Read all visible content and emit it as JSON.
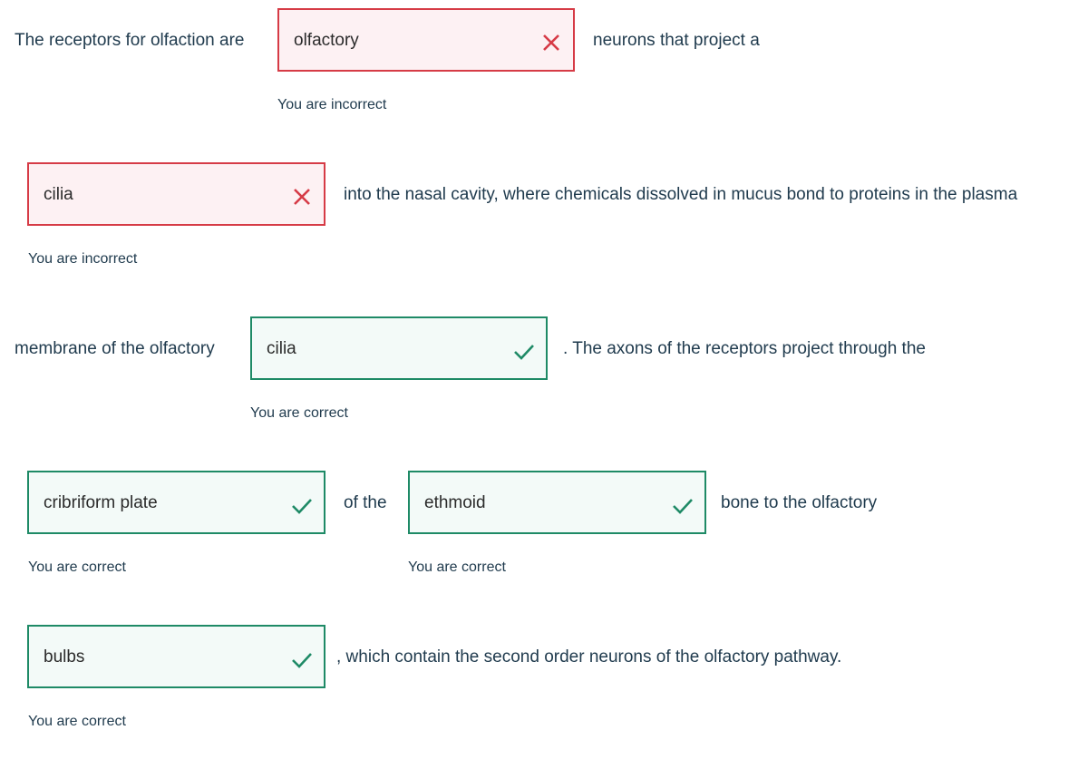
{
  "colors": {
    "incorrect_border": "#d63b46",
    "incorrect_bg": "#fdf1f3",
    "correct_border": "#1e8a66",
    "correct_bg": "#f3faf8",
    "text": "#1f3a4d"
  },
  "segments": {
    "s1": "The receptors for olfaction are",
    "s2": "neurons that project a",
    "s3": "into the nasal cavity, where chemicals dissolved in mucus bond to proteins in the plasma",
    "s4": "membrane of the olfactory",
    "s5": ". The axons of the receptors project through the",
    "s6": "of the",
    "s7": "bone to the olfactory",
    "s8": ", which contain the second order neurons of the olfactory pathway."
  },
  "blanks": [
    {
      "value": "olfactory",
      "status": "incorrect",
      "icon": "x-icon",
      "feedback": "You are incorrect"
    },
    {
      "value": "cilia",
      "status": "incorrect",
      "icon": "x-icon",
      "feedback": "You are incorrect"
    },
    {
      "value": "cilia",
      "status": "correct",
      "icon": "check-icon",
      "feedback": "You are correct"
    },
    {
      "value": "cribriform plate",
      "status": "correct",
      "icon": "check-icon",
      "feedback": "You are correct"
    },
    {
      "value": "ethmoid",
      "status": "correct",
      "icon": "check-icon",
      "feedback": "You are correct"
    },
    {
      "value": "bulbs",
      "status": "correct",
      "icon": "check-icon",
      "feedback": "You are correct"
    }
  ]
}
